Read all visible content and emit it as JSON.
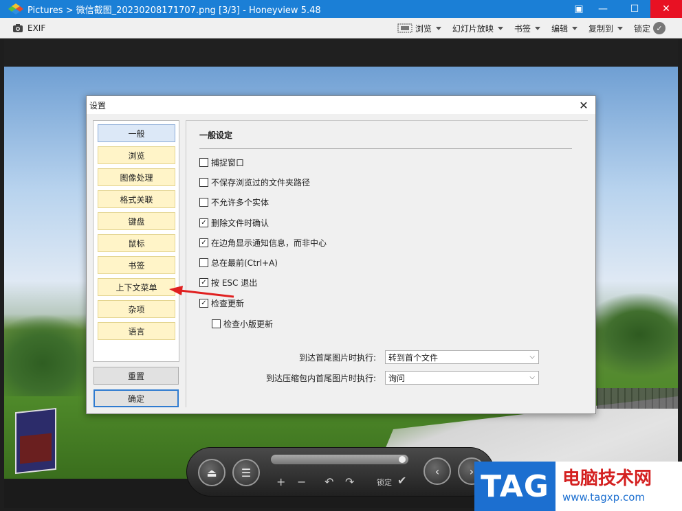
{
  "window": {
    "title": "Pictures > 微信截图_20230208171707.png [3/3] - Honeyview 5.48",
    "controls": [
      "▣",
      "—",
      "☐",
      "✕"
    ]
  },
  "toolbar": {
    "exif": "EXIF",
    "items": [
      "浏览",
      "幻灯片放映",
      "书签",
      "编辑",
      "复制到"
    ],
    "lock": "锁定"
  },
  "dialog": {
    "title": "设置",
    "nav": [
      "一般",
      "浏览",
      "图像处理",
      "格式关联",
      "键盘",
      "鼠标",
      "书签",
      "上下文菜单",
      "杂项",
      "语言"
    ],
    "reset": "重置",
    "ok": "确定",
    "section_title": "一般设定",
    "options": [
      {
        "label": "捕捉窗口",
        "checked": false
      },
      {
        "label": "不保存浏览过的文件夹路径",
        "checked": false
      },
      {
        "label": "不允许多个实体",
        "checked": false
      },
      {
        "label": "删除文件时确认",
        "checked": true
      },
      {
        "label": "在边角显示通知信息，而非中心",
        "checked": true
      },
      {
        "label": "总在最前(Ctrl+A)",
        "checked": false
      },
      {
        "label": "按 ESC 退出",
        "checked": true
      },
      {
        "label": "检查更新",
        "checked": true
      },
      {
        "label": "检查小版更新",
        "checked": false
      }
    ],
    "end_action_label": "到达首尾图片时执行:",
    "end_action_value": "转到首个文件",
    "archive_end_label": "到达压缩包内首尾图片时执行:",
    "archive_end_value": "询问"
  },
  "player": {
    "plus": "+",
    "minus": "−",
    "lock": "锁定"
  },
  "watermark": {
    "tag": "TAG",
    "title": "电脑技术网",
    "url": "www.tagxp.com"
  },
  "colors": {
    "titlebar": "#1b7fd6",
    "nav_bg": "#fff4c8",
    "arrow": "#e02020"
  }
}
